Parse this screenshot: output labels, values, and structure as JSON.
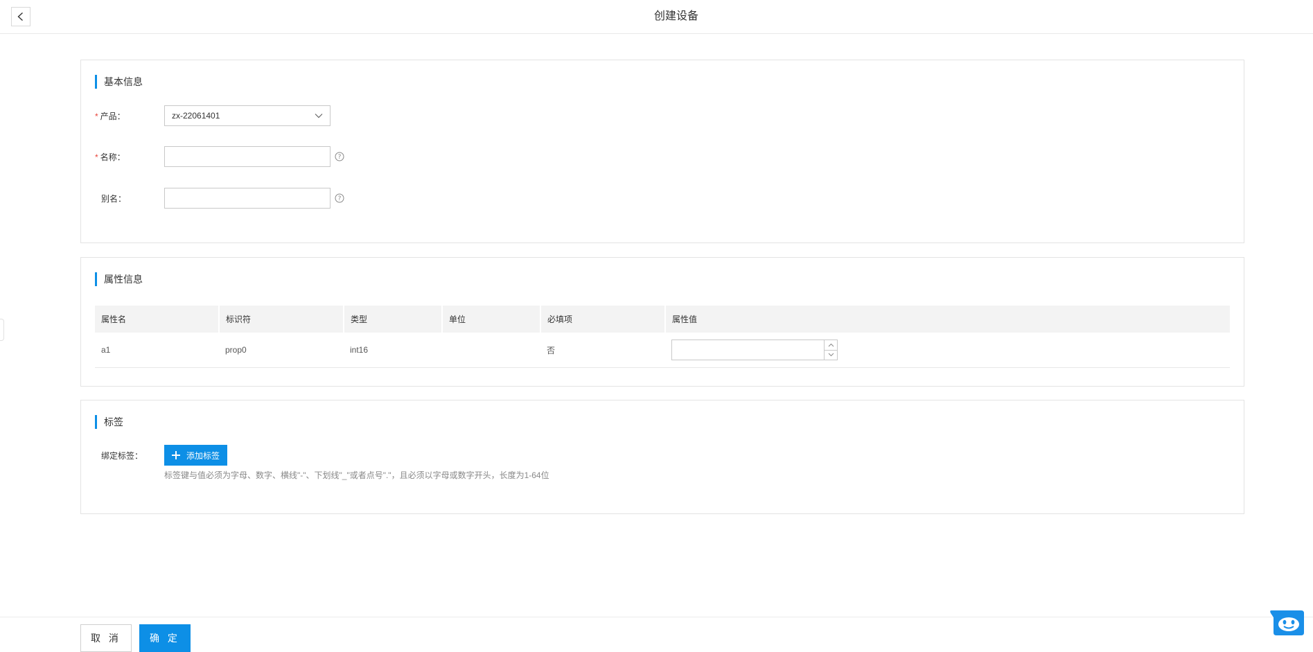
{
  "header": {
    "title": "创建设备",
    "back_icon": "chevron-left-icon"
  },
  "basic_info": {
    "title": "基本信息",
    "product": {
      "label": "产品：",
      "required": true,
      "value": "zx-22061401"
    },
    "name": {
      "label": "名称：",
      "required": true,
      "value": "",
      "placeholder": ""
    },
    "alias": {
      "label": "别名：",
      "required": false,
      "value": "",
      "placeholder": ""
    }
  },
  "attributes": {
    "title": "属性信息",
    "columns": [
      "属性名",
      "标识符",
      "类型",
      "单位",
      "必填项",
      "属性值"
    ],
    "rows": [
      {
        "name": "a1",
        "identifier": "prop0",
        "type": "int16",
        "unit": "",
        "required": "否",
        "value": ""
      }
    ]
  },
  "tags": {
    "title": "标签",
    "bind_label": "绑定标签：",
    "add_button": "添加标签",
    "hint": "标签键与值必须为字母、数字、横线\"-\"、下划线\"_\"或者点号\".\"，且必须以字母或数字开头，长度为1-64位"
  },
  "footer": {
    "cancel": "取 消",
    "confirm": "确 定"
  },
  "colors": {
    "primary": "#0d8fe6",
    "required": "#e8433a"
  }
}
